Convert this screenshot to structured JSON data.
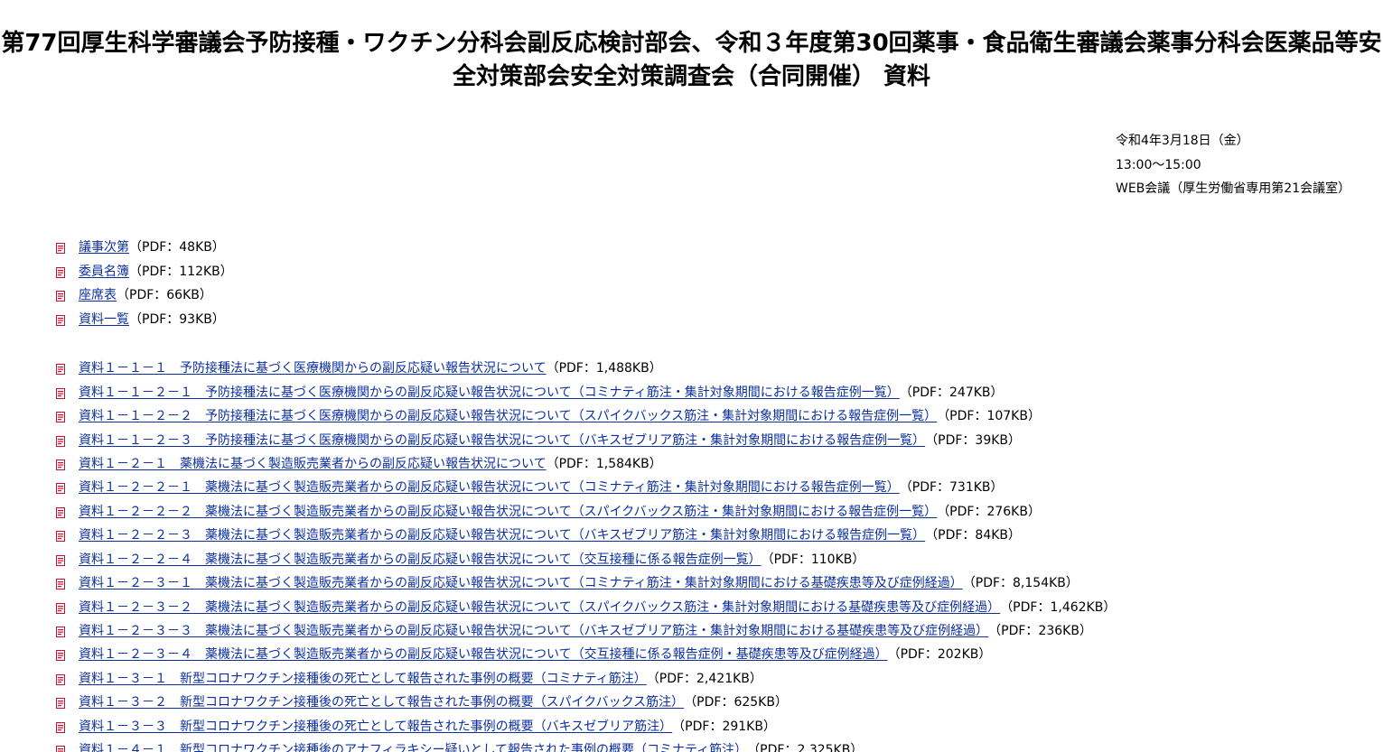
{
  "page": {
    "title": "第77回厚生科学審議会予防接種・ワクチン分科会副反応検討部会、令和３年度第30回薬事・食品衛生審議会薬事分科会医薬品等安全対策部会安全対策調査会（合同開催） 資料"
  },
  "meeting": {
    "date": "令和4年3月18日（金）",
    "time": "13:00〜15:00",
    "venue": "WEB会議（厚生労働省専用第21会議室）"
  },
  "documents_group1": [
    {
      "label": "議事次第",
      "size": "（PDF：48KB）"
    },
    {
      "label": "委員名簿",
      "size": "（PDF：112KB）"
    },
    {
      "label": "座席表",
      "size": "（PDF：66KB）"
    },
    {
      "label": "資料一覧",
      "size": "（PDF：93KB）"
    }
  ],
  "documents_group2": [
    {
      "label": "資料１－１－１　予防接種法に基づく医療機関からの副反応疑い報告状況について",
      "size": "（PDF：1,488KB）"
    },
    {
      "label": "資料１－１－２－１　予防接種法に基づく医療機関からの副反応疑い報告状況について（コミナティ筋注・集計対象期間における報告症例一覧）",
      "size": "（PDF：247KB）"
    },
    {
      "label": "資料１－１－２－２　予防接種法に基づく医療機関からの副反応疑い報告状況について（スパイクバックス筋注・集計対象期間における報告症例一覧）",
      "size": "（PDF：107KB）"
    },
    {
      "label": "資料１－１－２－３　予防接種法に基づく医療機関からの副反応疑い報告状況について（バキスゼブリア筋注・集計対象期間における報告症例一覧）",
      "size": "（PDF：39KB）"
    },
    {
      "label": "資料１－２－１　薬機法に基づく製造販売業者からの副反応疑い報告状況について",
      "size": "（PDF：1,584KB）"
    },
    {
      "label": "資料１－２－２－１　薬機法に基づく製造販売業者からの副反応疑い報告状況について（コミナティ筋注・集計対象期間における報告症例一覧）",
      "size": "（PDF：731KB）"
    },
    {
      "label": "資料１－２－２－２　薬機法に基づく製造販売業者からの副反応疑い報告状況について（スパイクバックス筋注・集計対象期間における報告症例一覧）",
      "size": "（PDF：276KB）"
    },
    {
      "label": "資料１－２－２－３　薬機法に基づく製造販売業者からの副反応疑い報告状況について（バキスゼブリア筋注・集計対象期間における報告症例一覧）",
      "size": "（PDF：84KB）"
    },
    {
      "label": "資料１－２－２－４　薬機法に基づく製造販売業者からの副反応疑い報告状況について（交互接種に係る報告症例一覧）",
      "size": "（PDF：110KB）"
    },
    {
      "label": "資料１－２－３－１　薬機法に基づく製造販売業者からの副反応疑い報告状況について（コミナティ筋注・集計対象期間における基礎疾患等及び症例経過）",
      "size": "（PDF：8,154KB）"
    },
    {
      "label": "資料１－２－３－２　薬機法に基づく製造販売業者からの副反応疑い報告状況について（スパイクバックス筋注・集計対象期間における基礎疾患等及び症例経過）",
      "size": "（PDF：1,462KB）"
    },
    {
      "label": "資料１－２－３－３　薬機法に基づく製造販売業者からの副反応疑い報告状況について（バキスゼブリア筋注・集計対象期間における基礎疾患等及び症例経過）",
      "size": "（PDF：236KB）"
    },
    {
      "label": "資料１－２－３－４　薬機法に基づく製造販売業者からの副反応疑い報告状況について（交互接種に係る報告症例・基礎疾患等及び症例経過）",
      "size": "（PDF：202KB）"
    },
    {
      "label": "資料１－３－１　新型コロナワクチン接種後の死亡として報告された事例の概要（コミナティ筋注）",
      "size": "（PDF：2,421KB）"
    },
    {
      "label": "資料１－３－２　新型コロナワクチン接種後の死亡として報告された事例の概要（スパイクバックス筋注）",
      "size": "（PDF：625KB）"
    },
    {
      "label": "資料１－３－３　新型コロナワクチン接種後の死亡として報告された事例の概要（バキスゼブリア筋注）",
      "size": "（PDF：291KB）"
    },
    {
      "label": "資料１－４－１　新型コロナワクチン接種後のアナフィラキシー疑いとして報告された事例の概要（コミナティ筋注）",
      "size": "（PDF：2,325KB）"
    }
  ],
  "colors": {
    "link": "#0b2f9e",
    "pdf_icon": "#c8102e"
  }
}
